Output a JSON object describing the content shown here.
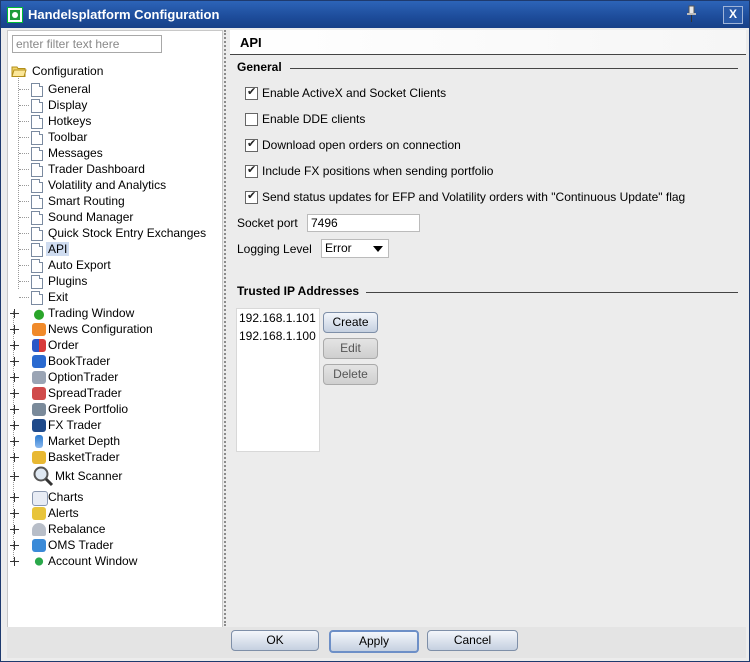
{
  "window": {
    "title": "Handelsplatform Configuration",
    "close_label": "X"
  },
  "filter": {
    "placeholder": "enter filter text here"
  },
  "tree": {
    "root": "Configuration",
    "children": [
      "General",
      "Display",
      "Hotkeys",
      "Toolbar",
      "Messages",
      "Trader Dashboard",
      "Volatility and Analytics",
      "Smart Routing",
      "Sound Manager",
      "Quick Stock Entry Exchanges",
      "API",
      "Auto Export",
      "Plugins",
      "Exit"
    ],
    "groups": [
      "Trading Window",
      "News Configuration",
      "Order",
      "BookTrader",
      "OptionTrader",
      "SpreadTrader",
      "Greek Portfolio",
      "FX Trader",
      "Market Depth",
      "BasketTrader",
      "Mkt Scanner",
      "Charts",
      "Alerts",
      "Rebalance",
      "OMS Trader",
      "Account Window"
    ],
    "selected": "API"
  },
  "panel": {
    "title": "API",
    "general_label": "General",
    "checkboxes": [
      {
        "label": "Enable ActiveX and Socket Clients",
        "checked": true
      },
      {
        "label": "Enable DDE clients",
        "checked": false
      },
      {
        "label": "Download open orders on connection",
        "checked": true
      },
      {
        "label": "Include FX positions when sending portfolio",
        "checked": true
      },
      {
        "label": "Send status updates for EFP and Volatility orders with \"Continuous Update\" flag",
        "checked": true
      }
    ],
    "socket_port_label": "Socket port",
    "socket_port_value": "7496",
    "logging_level_label": "Logging Level",
    "logging_level_value": "Error",
    "trusted_ip_label": "Trusted IP Addresses",
    "ip_addresses": [
      "192.168.1.101",
      "192.168.1.100"
    ],
    "buttons": {
      "create": "Create",
      "edit": "Edit",
      "delete": "Delete"
    }
  },
  "footer": {
    "ok": "OK",
    "apply": "Apply",
    "cancel": "Cancel"
  }
}
